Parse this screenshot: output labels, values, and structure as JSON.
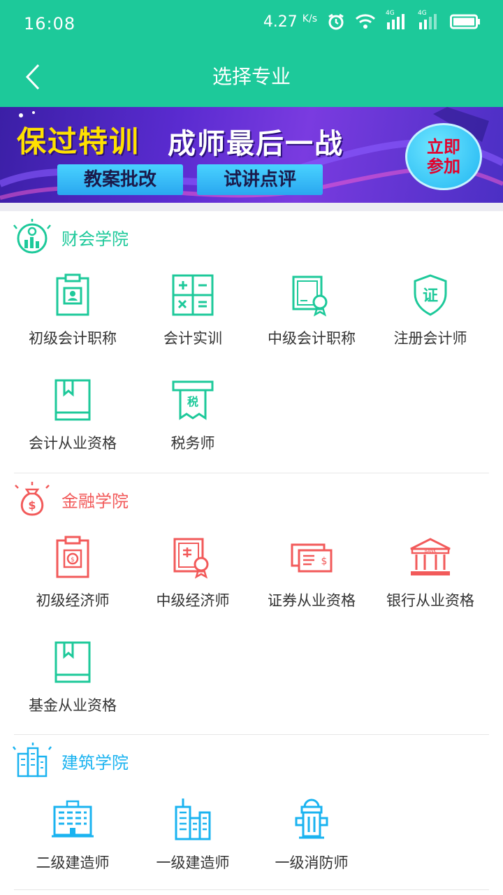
{
  "status": {
    "time": "16:08",
    "speed": "4.27",
    "speed_unit": "K/s",
    "net1": "4G",
    "net2": "4G"
  },
  "nav": {
    "title": "选择专业"
  },
  "banner": {
    "headline": "保过特训",
    "subline": "成师最后一战",
    "tag1": "教案批改",
    "tag2": "试讲点评",
    "cta_line1": "立即",
    "cta_line2": "参加"
  },
  "colors": {
    "primary": "#1dc99a",
    "finance": "#f25a5a",
    "build": "#1ab3f0"
  },
  "sections": [
    {
      "title": "财会学院",
      "items": [
        "初级会计职称",
        "会计实训",
        "中级会计职称",
        "注册会计师",
        "会计从业资格",
        "税务师"
      ]
    },
    {
      "title": "金融学院",
      "items": [
        "初级经济师",
        "中级经济师",
        "证券从业资格",
        "银行从业资格",
        "基金从业资格"
      ]
    },
    {
      "title": "建筑学院",
      "items": [
        "二级建造师",
        "一级建造师",
        "一级消防师"
      ]
    }
  ],
  "icon_glyphs": {
    "tax": "税",
    "cert": "证",
    "bank": "BANK"
  }
}
